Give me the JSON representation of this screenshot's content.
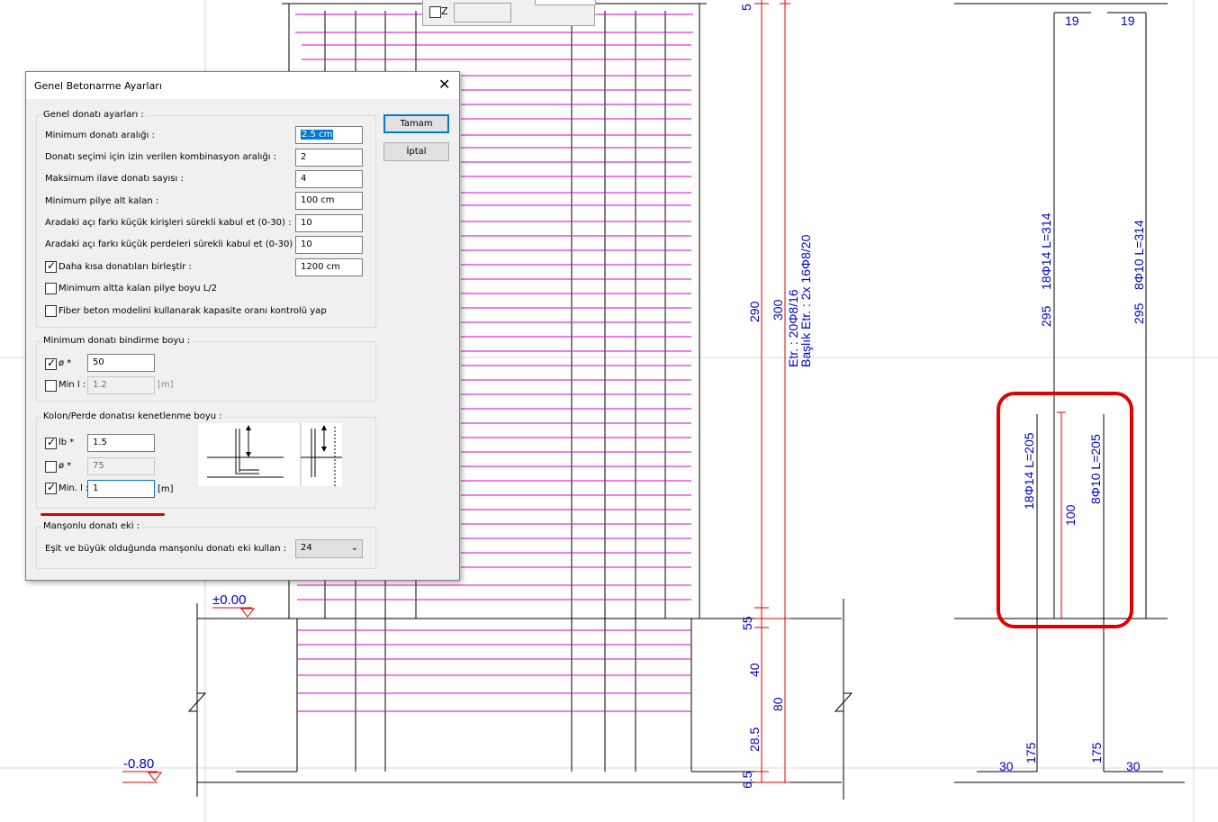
{
  "drawing": {
    "levels": {
      "zero": "±0.00",
      "bottom": "-0.80"
    },
    "dims_left": [
      "5",
      "290",
      "55",
      "40",
      "28.5",
      "6.5"
    ],
    "dims_mid": [
      "300",
      "80"
    ],
    "stirrup_text_1": "Etr. : 20Φ8/16",
    "stirrup_text_2": "Başlık Etr. : 2x 16Φ8/20",
    "right": {
      "top_dims": [
        "19",
        "19"
      ],
      "bar_left_upper": "18Φ14  L=314",
      "bar_right_upper": "8Φ10  L=314",
      "len_left_upper": "295",
      "len_right_upper": "295",
      "bar_left_lower": "18Φ14  L=205",
      "bar_right_lower": "8Φ10  L=205",
      "anchor_dim": "100",
      "bottom_len_left": "175",
      "bottom_len_right": "175",
      "hook_left": "30",
      "hook_right": "30"
    },
    "colors": {
      "rebar": "#d400d4",
      "dim": "#0000cc",
      "red": "#e00000",
      "line": "#000000"
    }
  },
  "top_panel": {
    "checkbox_label": "Z"
  },
  "dialog": {
    "title": "Genel Betonarme Ayarları",
    "close_icon": "close-icon",
    "ok_label": "Tamam",
    "cancel_label": "İptal",
    "general": {
      "legend": "Genel donatı ayarları :",
      "min_spacing": {
        "label": "Minimum donatı aralığı :",
        "value": "2.5 cm"
      },
      "combo_range": {
        "label": "Donatı seçimi için izin verilen kombinasyon aralığı :",
        "value": "2"
      },
      "max_extra": {
        "label": "Maksimum ilave donatı sayısı :",
        "value": "4"
      },
      "min_pile": {
        "label": "Minimum pilye alt kalan :",
        "value": "100 cm"
      },
      "beam_diff": {
        "label": "Aradaki açı farkı küçük kirişleri sürekli kabul et (0-30) :",
        "value": "10"
      },
      "wall_diff": {
        "label": "Aradaki açı farkı küçük perdeleri sürekli kabul et (0-30) :",
        "value": "10"
      },
      "merge_short": {
        "label": "Daha kısa donatıları birleştir :",
        "value": "1200 cm",
        "checked": true
      },
      "min_pile_half": {
        "label": "Minimum altta kalan pilye boyu L/2",
        "checked": false
      },
      "fiber": {
        "label": "Fiber beton modelini kullanarak kapasite oranı kontrolü yap",
        "checked": false
      }
    },
    "lap": {
      "legend": "Minimum donatı bindirme boyu :",
      "phi": {
        "label": "ø *",
        "value": "50",
        "checked": true
      },
      "minl": {
        "label": "Min l :",
        "value": "1.2",
        "unit": "[m]",
        "checked": false
      }
    },
    "anchor": {
      "legend": "Kolon/Perde donatısı kenetlenme boyu :",
      "lb": {
        "label": "lb *",
        "value": "1.5",
        "checked": true
      },
      "phi": {
        "label": "ø *",
        "value": "75",
        "checked": false
      },
      "minl": {
        "label": "Min. l :",
        "value": "1",
        "unit": "[m]",
        "checked": true
      }
    },
    "coupler": {
      "legend": "Manşonlu donatı eki :",
      "label": "Eşit ve büyük olduğunda manşonlu donatı eki kullan :",
      "value": "24"
    }
  }
}
